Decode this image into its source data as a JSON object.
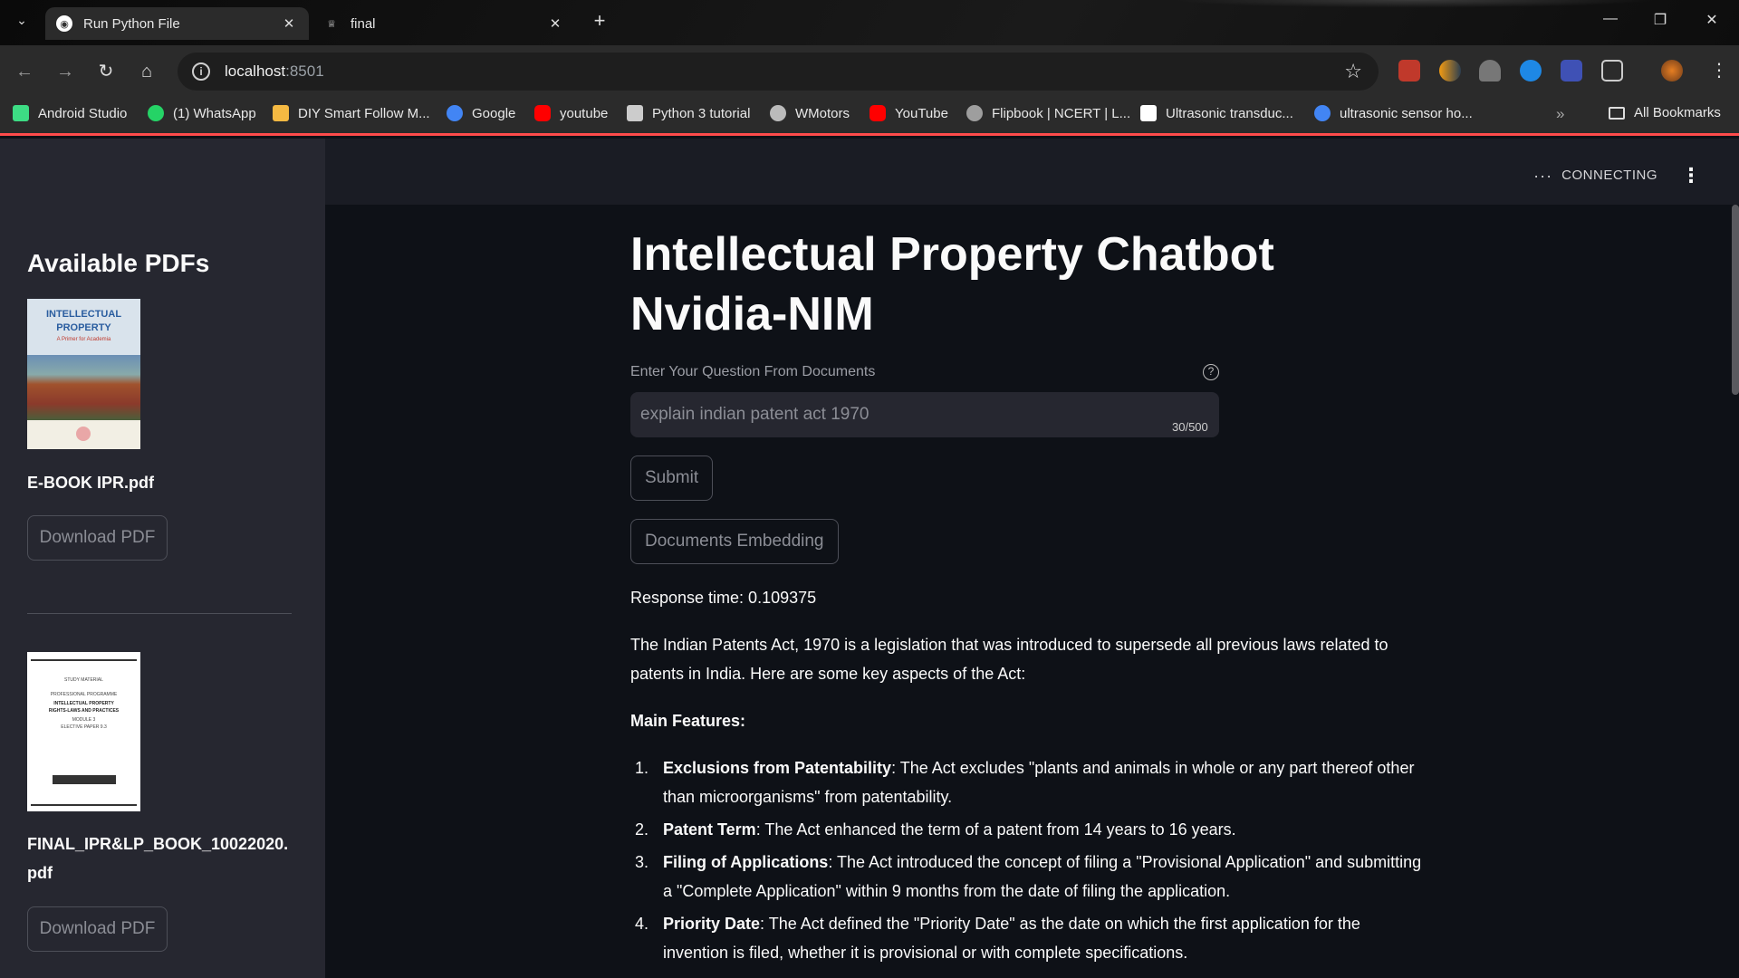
{
  "browser": {
    "tabs": [
      {
        "label": "Run Python File",
        "active": true
      },
      {
        "label": "final",
        "active": false
      }
    ],
    "url_host": "localhost",
    "url_port": ":8501",
    "bookmarks": [
      {
        "label": "Android Studio",
        "color": "#3ddc84"
      },
      {
        "label": "(1) WhatsApp",
        "color": "#25d366"
      },
      {
        "label": "DIY Smart Follow M...",
        "color": "#f5b942"
      },
      {
        "label": "Google",
        "color": "#4285f4"
      },
      {
        "label": "youtube",
        "color": "#ff0000"
      },
      {
        "label": "Python 3 tutorial",
        "color": "#cccccc"
      },
      {
        "label": "WMotors",
        "color": "#bbbbbb"
      },
      {
        "label": "YouTube",
        "color": "#ff0000"
      },
      {
        "label": "Flipbook | NCERT | L...",
        "color": "#9e9e9e"
      },
      {
        "label": "Ultrasonic transduc...",
        "color": "#ffffff"
      },
      {
        "label": "ultrasonic sensor ho...",
        "color": "#4285f4"
      }
    ],
    "all_bookmarks": "All Bookmarks"
  },
  "app": {
    "status": "CONNECTING",
    "sidebar": {
      "title": "Available PDFs",
      "pdfs": [
        {
          "name": "E-BOOK IPR.pdf",
          "button": "Download PDF",
          "cover_title": "INTELLECTUAL PROPERTY",
          "cover_subtitle": "A Primer for Academia"
        },
        {
          "name": "FINAL_IPR&LP_BOOK_10022020.pdf",
          "name_line1": "FINAL_IPR&LP_BOOK_10022020.",
          "name_line2": "pdf",
          "button": "Download PDF",
          "cover_lines": [
            "STUDY MATERIAL",
            "PROFESSIONAL PROGRAMME",
            "INTELLECTUAL PROPERTY",
            "RIGHTS-LAWS AND PRACTICES",
            "MODULE 3",
            "ELECTIVE PAPER 9.3"
          ]
        }
      ]
    },
    "main": {
      "title_line1": "Intellectual Property Chatbot",
      "title_line2": "Nvidia-NIM",
      "question_label": "Enter Your Question From Documents",
      "question_value": "explain indian patent act 1970",
      "char_count": "30/500",
      "submit_label": "Submit",
      "embedding_label": "Documents Embedding",
      "response_time": "Response time: 0.109375",
      "answer_intro": "The Indian Patents Act, 1970 is a legislation that was introduced to supersede all previous laws related to patents in India. Here are some key aspects of the Act:",
      "answer_heading": "Main Features:",
      "answer_items": [
        {
          "num": "1.",
          "term": "Exclusions from Patentability",
          "text": ": The Act excludes \"plants and animals in whole or any part thereof other than microorganisms\" from patentability."
        },
        {
          "num": "2.",
          "term": "Patent Term",
          "text": ": The Act enhanced the term of a patent from 14 years to 16 years."
        },
        {
          "num": "3.",
          "term": "Filing of Applications",
          "text": ": The Act introduced the concept of filing a \"Provisional Application\" and submitting a \"Complete Application\" within 9 months from the date of filing the application."
        },
        {
          "num": "4.",
          "term": "Priority Date",
          "text": ": The Act defined the \"Priority Date\" as the date on which the first application for the invention is filed, whether it is provisional or with complete specifications."
        }
      ]
    }
  }
}
